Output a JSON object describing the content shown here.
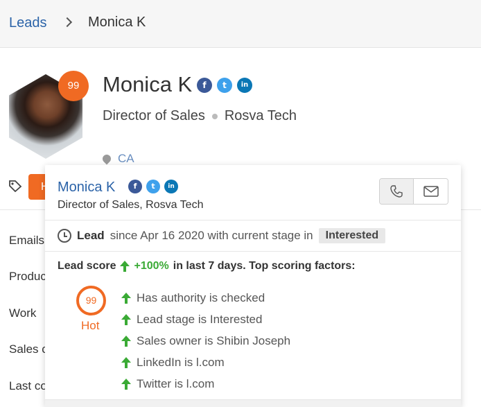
{
  "breadcrumb": {
    "parent": "Leads",
    "current": "Monica K"
  },
  "profile": {
    "name": "Monica K",
    "score": "99",
    "job_title": "Director of Sales",
    "company": "Rosva Tech",
    "location": "CA",
    "social": {
      "facebook": "f",
      "twitter": "t",
      "linkedin": "in"
    },
    "hot_pill_label": "H"
  },
  "fields": [
    "Emails",
    "Produc",
    "Work",
    "Sales c",
    "Last co"
  ],
  "card": {
    "name": "Monica K",
    "subtitle": "Director of Sales, Rosva Tech",
    "stage_prefix_bold": "Lead",
    "stage_text": "since Apr 16 2020 with current stage in",
    "stage_badge": "Interested",
    "score_label": "Lead score",
    "score_change": "+100%",
    "score_suffix": "in last 7 days. Top scoring factors:",
    "score_value": "99",
    "score_category": "Hot",
    "factors": [
      "Has authority is checked",
      "Lead stage is Interested",
      "Sales owner is Shibin Joseph",
      "LinkedIn is l.com",
      "Twitter is l.com"
    ]
  },
  "colors": {
    "accent": "#f06a23",
    "link": "#2b63a8",
    "positive": "#3aaa35"
  }
}
